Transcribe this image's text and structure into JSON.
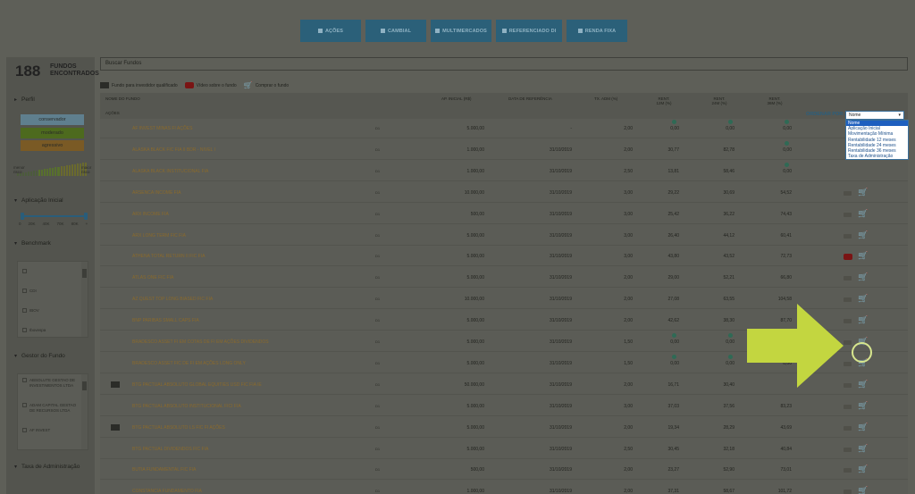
{
  "top_nav": [
    {
      "label": "AÇÕES",
      "width": 68
    },
    {
      "label": "CAMBIAL",
      "width": 68
    },
    {
      "label": "MULTIMERCADOS",
      "width": 68
    },
    {
      "label": "REFERENCIADO DI",
      "width": 68
    },
    {
      "label": "RENDA FIXA",
      "width": 68
    }
  ],
  "sidebar": {
    "count": "188",
    "count_label_1": "FUNDOS",
    "count_label_2": "ENCONTRADOS",
    "profile_title": "Perfil",
    "profiles": [
      {
        "label": "conservador",
        "color": "#5f7f8e"
      },
      {
        "label": "moderado",
        "color": "#4d6a1e"
      },
      {
        "label": "agressivo",
        "color": "#7a5a25"
      }
    ],
    "risk_low": "menor risco",
    "risk_high": "maior risco",
    "initial_title": "Aplicação Inicial",
    "initial_ticks": [
      "0",
      "20K",
      "40K",
      "70K",
      "80K",
      "+"
    ],
    "benchmark_title": "Benchmark",
    "benchmark_items": [
      "",
      "CDI",
      "IBOV",
      "Ibovespa"
    ],
    "manager_title": "Gestor do Fundo",
    "manager_items": [
      "ABSOLUTE GESTAO DE INVESTIMENTOS LTDA",
      "ADAM CAPITAL GESTAO DE RECURSOS LTDA",
      "AF INVEST"
    ],
    "fee_title": "Taxa de Administração"
  },
  "search": {
    "placeholder": "Buscar Fundos"
  },
  "legend": {
    "qualified": "Fundo para investidor qualificado",
    "video": "Vídeo sobre o fundo",
    "buy": "Comprar o fundo"
  },
  "table_header": {
    "name": "NOME DO FUNDO",
    "sub": "AÇÕES",
    "ap": "AP. INICIAL (R$)",
    "date": "DATA DE REFERÊNCIA",
    "fee": "TX. ADM (%)",
    "r12": "RENT. 12M (%)",
    "r24": "RENT. 24M (%)",
    "r36": "RENT. 36M (%)",
    "order_by": "ORDENAR POR:"
  },
  "sort": {
    "selected": "Nome",
    "options": [
      "Nome",
      "Aplicação Inicial",
      "Movimentação Mínima",
      "Rentabilidade 12 meses",
      "Rentabilidade 24 meses",
      "Rentabilidade 36 meses",
      "Taxa de Administração"
    ]
  },
  "rows": [
    {
      "name": "AF INVEST MINAS FI AÇÕES",
      "q": "D1",
      "ap": "5.000,00",
      "date": "-",
      "fee": "2,00",
      "r12": "0,00",
      "r24": "0,00",
      "r36": "0,00",
      "qual": false,
      "yt": false
    },
    {
      "name": "ALASKA BLACK FIC FIA II BDR - NIVEL I",
      "q": "D1",
      "ap": "1.000,00",
      "date": "31/10/2019",
      "fee": "2,00",
      "r12": "30,77",
      "r24": "82,78",
      "r36": "0,00",
      "qual": false,
      "yt": false
    },
    {
      "name": "ALASKA BLACK INSTITUCIONAL FIA",
      "q": "D1",
      "ap": "1.000,00",
      "date": "31/10/2019",
      "fee": "2,50",
      "r12": "13,81",
      "r24": "58,46",
      "r36": "0,00",
      "qual": false,
      "yt": false
    },
    {
      "name": "ARSENCA INCOME FIA",
      "q": "D1",
      "ap": "10.000,00",
      "date": "31/10/2019",
      "fee": "3,00",
      "r12": "29,22",
      "r24": "30,69",
      "r36": "54,52",
      "qual": false,
      "yt": false
    },
    {
      "name": "ARX INCOME FIA",
      "q": "D1",
      "ap": "500,00",
      "date": "31/10/2019",
      "fee": "3,00",
      "r12": "25,42",
      "r24": "36,22",
      "r36": "74,43",
      "qual": false,
      "yt": false
    },
    {
      "name": "ARX LONG TERM FIC FIA",
      "q": "D1",
      "ap": "5.000,00",
      "date": "31/10/2019",
      "fee": "3,00",
      "r12": "26,40",
      "r24": "44,12",
      "r36": "60,41",
      "qual": false,
      "yt": false
    },
    {
      "name": "ATHENA TOTAL RETURN II FIC FIA",
      "q": "D1",
      "ap": "5.000,00",
      "date": "31/10/2019",
      "fee": "3,00",
      "r12": "43,80",
      "r24": "43,52",
      "r36": "72,73",
      "qual": false,
      "yt": true
    },
    {
      "name": "ATLAS ONE FIC FIA",
      "q": "D1",
      "ap": "5.000,00",
      "date": "31/10/2019",
      "fee": "2,00",
      "r12": "29,00",
      "r24": "52,21",
      "r36": "66,80",
      "qual": false,
      "yt": false
    },
    {
      "name": "AZ QUEST TOP LONG BIASED FIC FIA",
      "q": "D1",
      "ap": "10.000,00",
      "date": "31/10/2019",
      "fee": "2,00",
      "r12": "27,08",
      "r24": "63,55",
      "r36": "104,58",
      "qual": false,
      "yt": false
    },
    {
      "name": "BNP PARIBAS SMALL CAPS FIA",
      "q": "D1",
      "ap": "5.000,00",
      "date": "31/10/2019",
      "fee": "2,00",
      "r12": "42,62",
      "r24": "38,30",
      "r36": "87,70",
      "qual": false,
      "yt": false
    },
    {
      "name": "BRADESCO ASSET FI EM COTAS DE FI EM AÇÕES DIVIDENDOS",
      "q": "D1",
      "ap": "5.000,00",
      "date": "31/10/2019",
      "fee": "1,50",
      "r12": "0,00",
      "r24": "0,00",
      "r36": "0,00",
      "qual": false,
      "yt": false
    },
    {
      "name": "BRADESCO ASSET FIC DE FI EM AÇÕES LONG ONLY",
      "q": "D1",
      "ap": "5.000,00",
      "date": "31/10/2019",
      "fee": "1,50",
      "r12": "0,00",
      "r24": "0,00",
      "r36": "0,00",
      "qual": false,
      "yt": false
    },
    {
      "name": "BTG PACTUAL ABSOLUTO GLOBAL EQUITIES USD FIC FIA IE",
      "q": "D1",
      "ap": "50.000,00",
      "date": "31/10/2019",
      "fee": "2,00",
      "r12": "16,71",
      "r24": "30,40",
      "r36": "",
      "qual": true,
      "yt": false
    },
    {
      "name": "BTG PACTUAL ABSOLUTO INSTITUCIONAL FICI FIA",
      "q": "D1",
      "ap": "5.000,00",
      "date": "31/10/2019",
      "fee": "3,00",
      "r12": "37,03",
      "r24": "37,56",
      "r36": "83,23",
      "qual": false,
      "yt": false
    },
    {
      "name": "BTG PACTUAL ABSOLUTO LS FIC FI AÇÕES",
      "q": "D1",
      "ap": "5.000,00",
      "date": "31/10/2019",
      "fee": "2,00",
      "r12": "19,34",
      "r24": "28,29",
      "r36": "43,69",
      "qual": true,
      "yt": false
    },
    {
      "name": "BTG PACTUAL DIVIDENDOS FIC FIA",
      "q": "D1",
      "ap": "5.000,00",
      "date": "31/10/2019",
      "fee": "2,50",
      "r12": "30,45",
      "r24": "32,18",
      "r36": "40,84",
      "qual": false,
      "yt": false
    },
    {
      "name": "BUTIA FUNDAMENTAL FIC FIA",
      "q": "D1",
      "ap": "500,00",
      "date": "31/10/2019",
      "fee": "2,00",
      "r12": "23,27",
      "r24": "52,90",
      "r36": "73,01",
      "qual": false,
      "yt": false
    },
    {
      "name": "CONSTANCIA FUNDAMENTO FIA",
      "q": "D1",
      "ap": "1.000,00",
      "date": "31/10/2019",
      "fee": "2,00",
      "r12": "37,31",
      "r24": "58,67",
      "r36": "101,72",
      "qual": false,
      "yt": false
    }
  ],
  "colors": {
    "accent": "#2b6079",
    "arrow": "#c3d640",
    "highlight": "#d7e68d"
  }
}
